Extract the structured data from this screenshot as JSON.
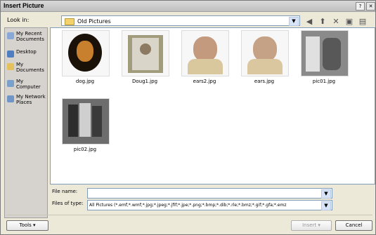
{
  "window": {
    "title": "Insert Picture"
  },
  "title_buttons": {
    "help_label": "?",
    "close_label": "✕"
  },
  "lookin": {
    "label": "Look in:",
    "value": "Old Pictures"
  },
  "toolbar": {
    "icons": [
      "back-icon",
      "up-one-level-icon",
      "delete-icon",
      "new-folder-icon",
      "views-icon"
    ]
  },
  "places": [
    {
      "label": "My Recent Documents",
      "icon": "recent-documents-icon"
    },
    {
      "label": "Desktop",
      "icon": "desktop-icon"
    },
    {
      "label": "My Documents",
      "icon": "my-documents-icon"
    },
    {
      "label": "My Computer",
      "icon": "my-computer-icon"
    },
    {
      "label": "My Network Places",
      "icon": "network-places-icon"
    }
  ],
  "files": [
    {
      "name": "dog.jpg"
    },
    {
      "name": "Doug1.jpg"
    },
    {
      "name": "ears2.jpg"
    },
    {
      "name": "ears.jpg"
    },
    {
      "name": "pic01.jpg"
    },
    {
      "name": "pic02.jpg"
    }
  ],
  "file_name": {
    "label": "File name:",
    "value": ""
  },
  "files_of_type": {
    "label": "Files of type:",
    "value": "All Pictures (*.emf;*.wmf;*.jpg;*.jpeg;*.jfif;*.jpe;*.png;*.bmp;*.dib;*.rle;*.bmz;*.gif;*.gfa;*.emz"
  },
  "buttons": {
    "tools": "Tools",
    "insert": "Insert",
    "cancel": "Cancel"
  }
}
